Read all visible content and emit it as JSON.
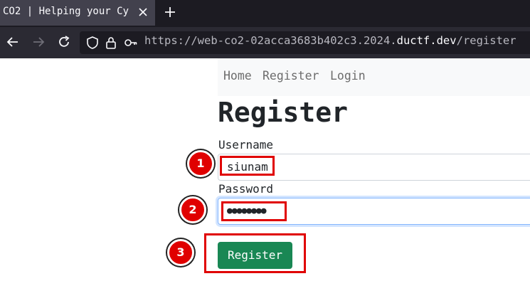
{
  "browser": {
    "tab_title": "CO2 | Helping your Cy",
    "url_prefix": "https://web-co2-02acca3683b402c3.2024.",
    "url_host": "ductf.dev",
    "url_path": "/register"
  },
  "site_nav": {
    "home": "Home",
    "register": "Register",
    "login": "Login"
  },
  "page": {
    "title": "Register",
    "username_label": "Username",
    "username_value": "siunam",
    "password_label": "Password",
    "password_value": "●●●●●●●●",
    "submit_label": "Register"
  },
  "annotations": {
    "step1": "1",
    "step2": "2",
    "step3": "3",
    "color": "#e00000"
  }
}
